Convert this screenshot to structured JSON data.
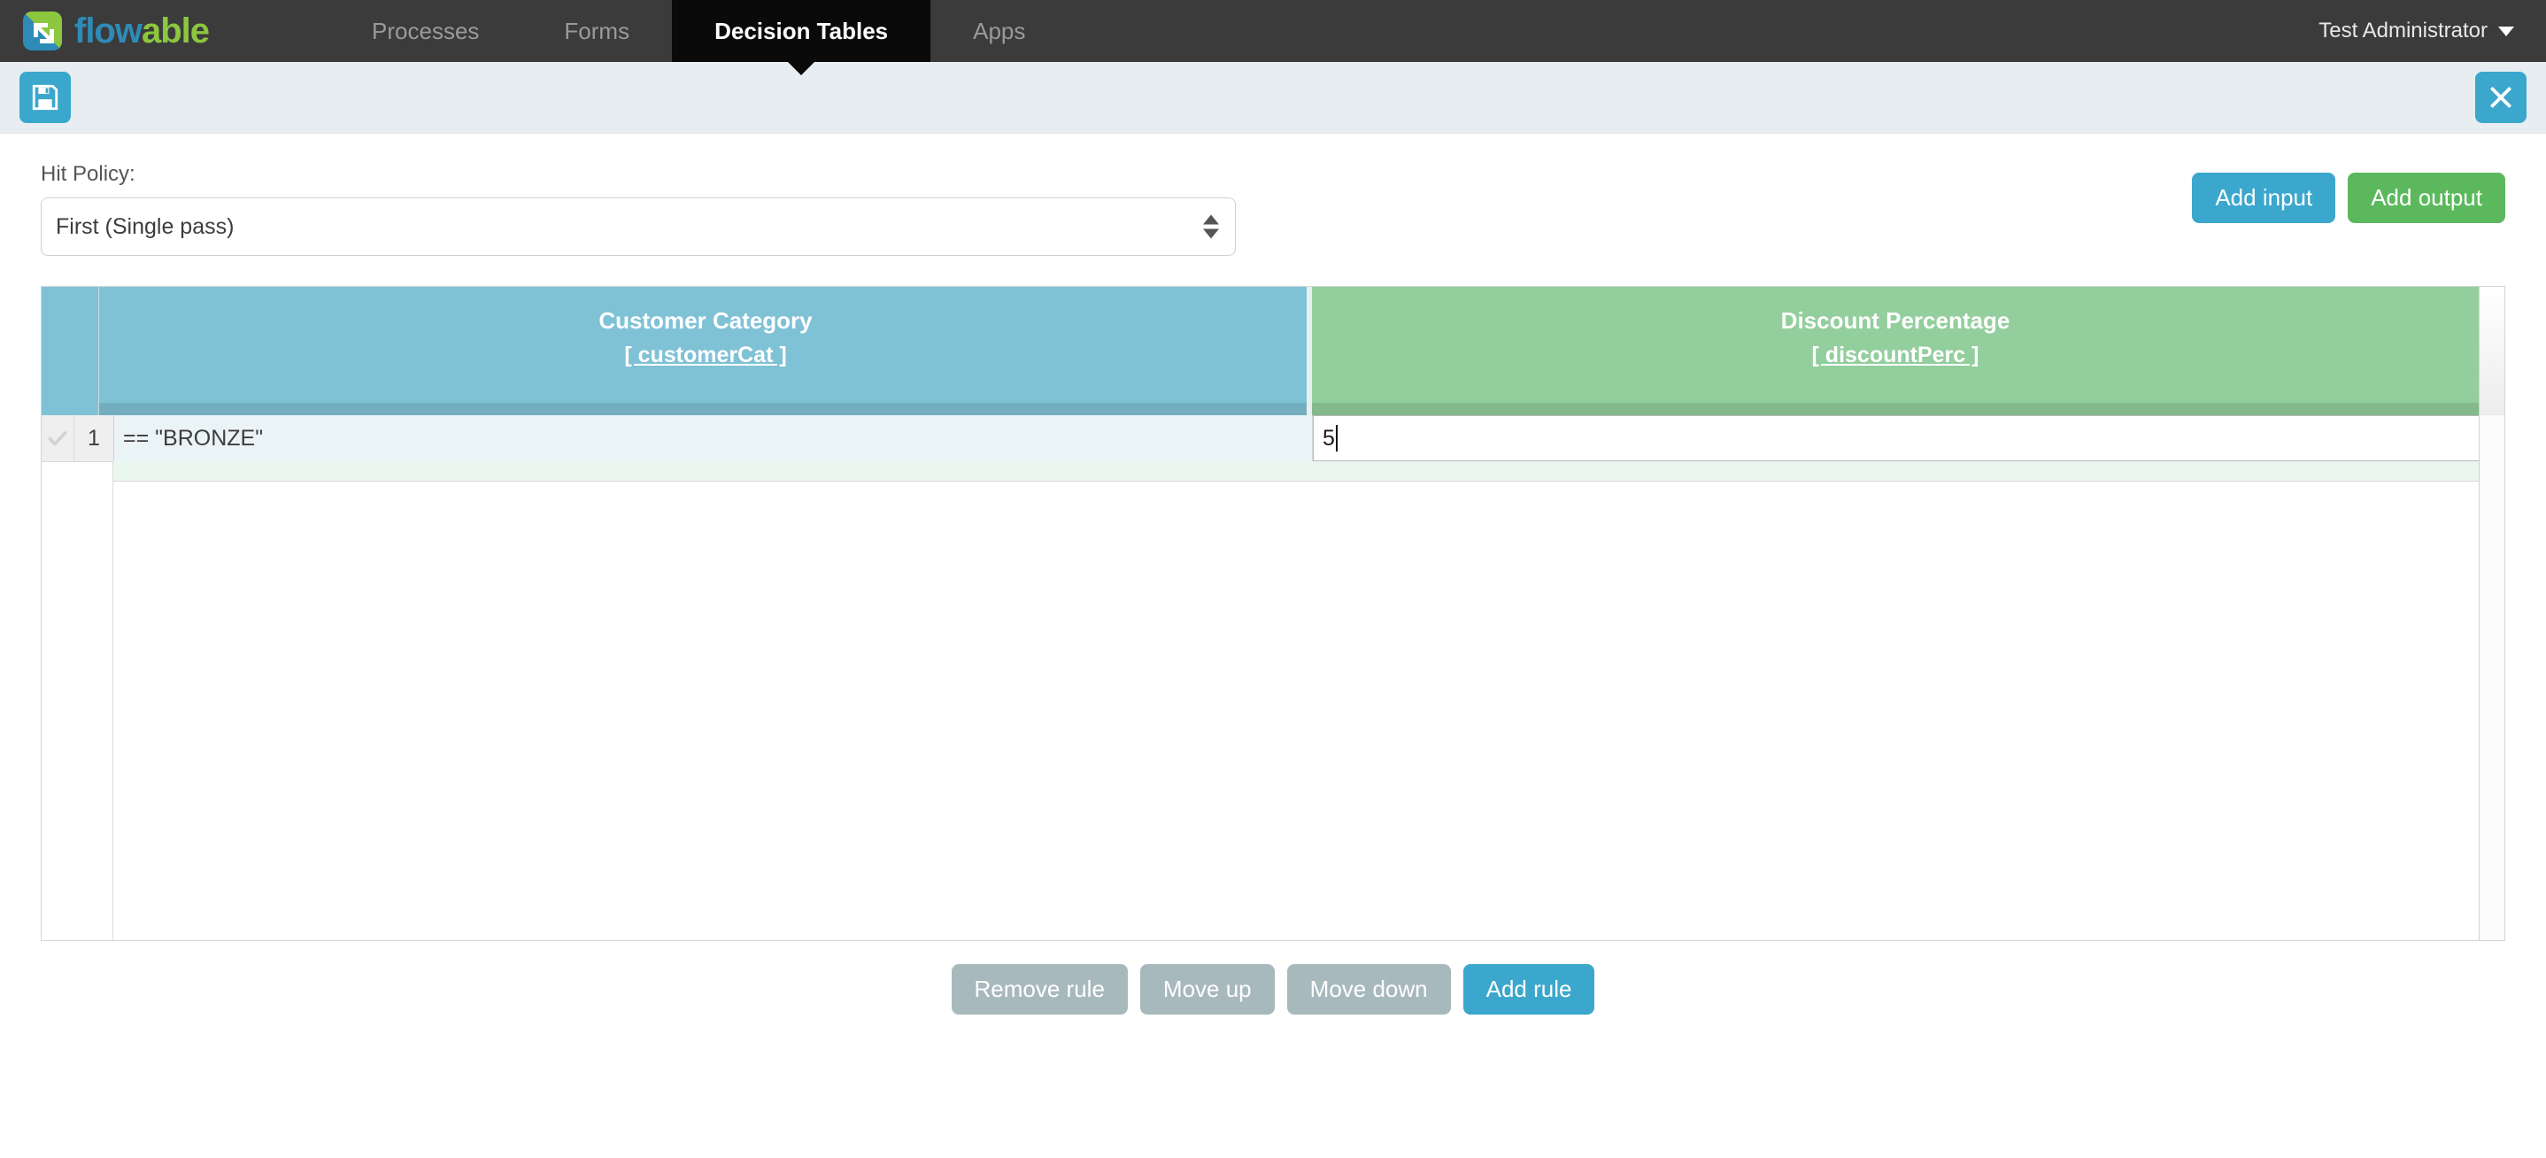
{
  "nav": {
    "brand": {
      "word1": "flow",
      "word2": "able",
      "icon": "flowable-logo-icon"
    },
    "tabs": [
      {
        "label": "Processes",
        "active": false
      },
      {
        "label": "Forms",
        "active": false
      },
      {
        "label": "Decision Tables",
        "active": true
      },
      {
        "label": "Apps",
        "active": false
      }
    ],
    "user": {
      "name": "Test Administrator",
      "icon": "chevron-down-icon"
    }
  },
  "toolbar": {
    "save_icon": "save-floppy-icon",
    "close_icon": "close-x-icon"
  },
  "editor": {
    "hit_policy_label": "Hit Policy:",
    "hit_policy_value": "First (Single pass)",
    "hit_policy_options": [
      "First (Single pass)"
    ],
    "add_input_label": "Add input",
    "add_output_label": "Add output"
  },
  "table": {
    "input_columns": [
      {
        "title": "Customer Category",
        "variable": "[ customerCat ]"
      }
    ],
    "output_columns": [
      {
        "title": "Discount Percentage",
        "variable": "[ discountPerc ]"
      }
    ],
    "rows": [
      {
        "number": "1",
        "checked_icon": "checkmark-icon",
        "input_values": [
          "== \"BRONZE\""
        ],
        "output_values": [
          "5"
        ],
        "editing": true
      }
    ]
  },
  "actions": {
    "remove_rule": "Remove rule",
    "move_up": "Move up",
    "move_down": "Move down",
    "add_rule": "Add rule"
  },
  "colors": {
    "brand_blue": "#2e8bb8",
    "brand_green": "#8dc63f",
    "accent_blue": "#3ba7cc",
    "accent_green": "#5cb85c",
    "input_header": "#7fc2d6",
    "output_header": "#93ce9d",
    "grey_button": "#a8b9bd",
    "navbar": "#3b3b3b",
    "toolbar": "#e7edf0"
  }
}
